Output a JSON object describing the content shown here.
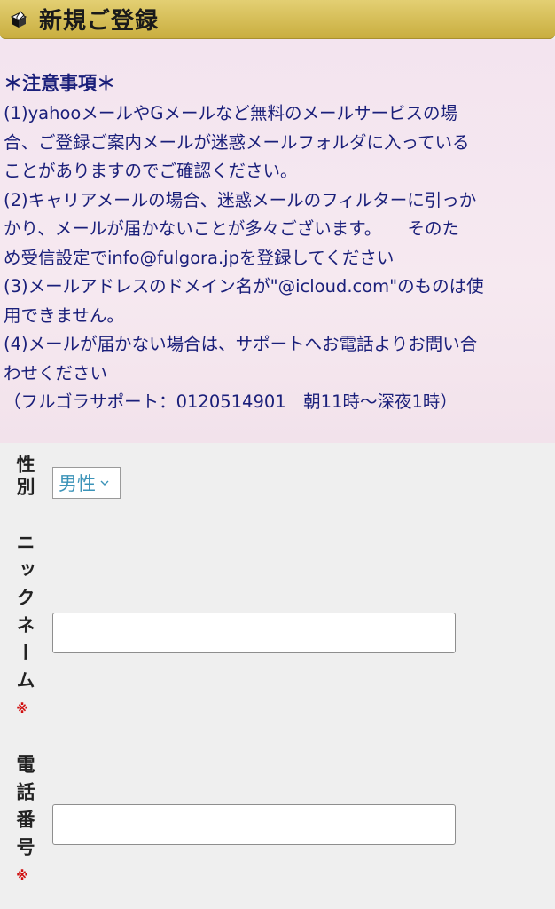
{
  "header": {
    "title": "新規ご登録"
  },
  "notice": {
    "heading": "＊注意事項＊",
    "lines": [
      "(1)yahooメールやGメールなど無料のメールサービスの場",
      "合、ご登録ご案内メールが迷惑メールフォルダに入っている",
      "ことがありますのでご確認ください。",
      "(2)キャリアメールの場合、迷惑メールのフィルターに引っか",
      "かり、メールが届かないことが多々ございます。　　そのた",
      "め受信設定でinfo@fulgora.jpを登録してください",
      "(3)メールアドレスのドメイン名が\"@icloud.com\"のものは使",
      "用できません。",
      "(4)メールが届かない場合は、サポートへお電話よりお問い合",
      "わせください",
      "（フルゴラサポート：0120514901　朝11時〜深夜1時）"
    ]
  },
  "form": {
    "gender": {
      "label": "性別",
      "selected": "男性"
    },
    "nickname": {
      "label": "ニックネーム",
      "required_mark": "※",
      "value": ""
    },
    "phone": {
      "label": "電話番号",
      "required_mark": "※",
      "value": ""
    }
  },
  "colors": {
    "header_gold": "#d4bb52",
    "notice_text": "#1a1f7a",
    "notice_bg": "#f5e6ef",
    "select_text": "#3b93b8",
    "required": "#d01010"
  }
}
